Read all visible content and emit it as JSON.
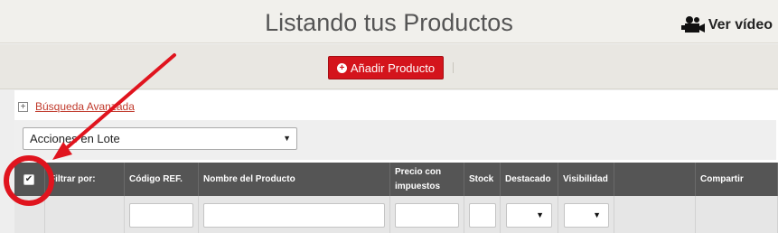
{
  "header": {
    "title": "Listando tus Productos",
    "video_label": "Ver vídeo",
    "video_icon": "video-camera-icon"
  },
  "toolbar": {
    "add_label": "Añadir Producto",
    "add_icon": "plus-circle-icon",
    "accent": "#d4141c"
  },
  "advanced_search": {
    "label": "Búsqueda Avanzada",
    "icon": "expand-plus-icon"
  },
  "bulk_actions": {
    "selected": "Acciones en Lote"
  },
  "table": {
    "headers": {
      "filter": "Filtrar por:",
      "ref": "Código REF.",
      "name": "Nombre del Producto",
      "price_line1": "Precio con",
      "price_line2": "impuestos",
      "stock": "Stock",
      "featured": "Destacado",
      "visibility": "Visibilidad",
      "share": "Compartir"
    },
    "select_all_checked": true
  },
  "annotation": {
    "color": "#e0141e"
  }
}
